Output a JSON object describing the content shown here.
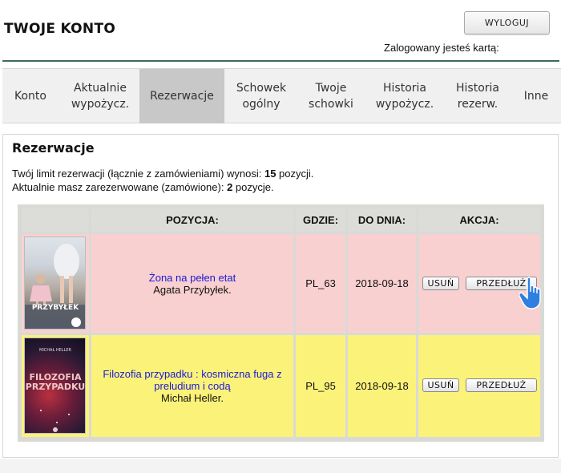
{
  "header": {
    "title": "TWOJE KONTO",
    "logout_label": "WYLOGUJ",
    "logged_in_text": "Zalogowany jesteś kartą:"
  },
  "nav": {
    "items": [
      {
        "label": "Konto"
      },
      {
        "label": "Aktualnie wypożycz."
      },
      {
        "label": "Rezerwacje"
      },
      {
        "label": "Schowek ogólny"
      },
      {
        "label": "Twoje schowki"
      },
      {
        "label": "Historia wypożycz."
      },
      {
        "label": "Historia rezerw."
      },
      {
        "label": "Inne"
      }
    ],
    "active": "Rezerwacje"
  },
  "section": {
    "title": "Rezerwacje",
    "limit_text_prefix": "Twój limit rezerwacji (łącznie z zamówieniami) wynosi: ",
    "limit_value": "15",
    "limit_text_suffix": " pozycji.",
    "current_text_prefix": "Aktualnie masz zarezerwowane (zamówione): ",
    "current_value": "2",
    "current_text_suffix": " pozycje."
  },
  "table": {
    "headers": [
      "POZYCJA:",
      "GDZIE:",
      "DO DNIA:",
      "AKCJA:"
    ],
    "rows": [
      {
        "title": "Żona na pełen etat",
        "author": "Agata Przybyłek.",
        "where": "PL_63",
        "until": "2018-09-18",
        "remove_label": "USUŃ",
        "extend_label": "PRZEDŁUŻ",
        "cover_text": "PRZYBYŁEK",
        "row_color": "#f9d0d0"
      },
      {
        "title": "Filozofia przypadku : kosmiczna fuga z preludium i codą",
        "author": "Michał Heller.",
        "where": "PL_95",
        "until": "2018-09-18",
        "remove_label": "USUŃ",
        "extend_label": "PRZEDŁUŻ",
        "cover_author": "MICHAŁ HELLER",
        "cover_title_1": "FILOZOFIA",
        "cover_title_2": "PRZYPADKU",
        "row_color": "#fbf27a"
      }
    ]
  },
  "cursor_icon": "hand-pointer-icon"
}
